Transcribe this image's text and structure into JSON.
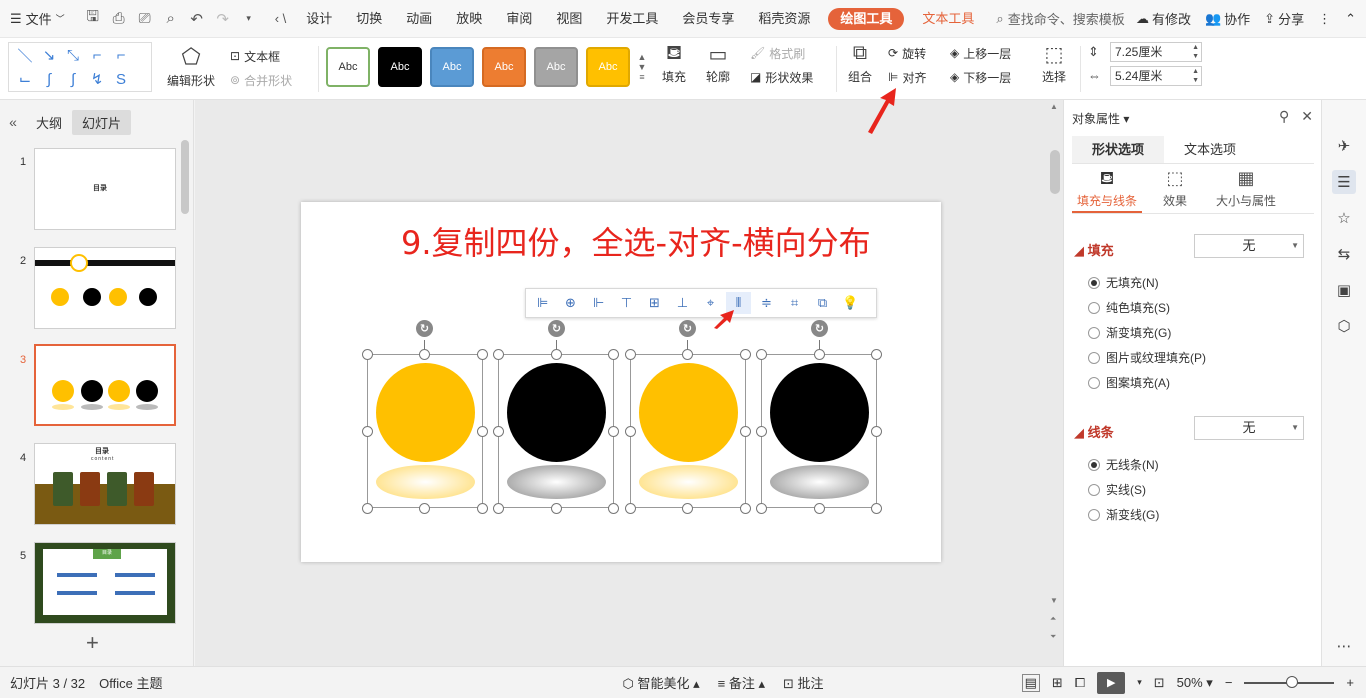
{
  "menubar": {
    "file_label": "文件",
    "tabs": [
      "设计",
      "切换",
      "动画",
      "放映",
      "审阅",
      "视图",
      "开发工具",
      "会员专享",
      "稻壳资源"
    ],
    "draw_tool": "绘图工具",
    "text_tool": "文本工具",
    "search_placeholder": "查找命令、搜索模板",
    "right": {
      "modify": "有修改",
      "collab": "协作",
      "share": "分享"
    }
  },
  "ribbon": {
    "edit_shape": "编辑形状",
    "textbox": "文本框",
    "merge_shape": "合并形状",
    "style_label": "Abc",
    "styles": [
      {
        "bg": "#ffffff",
        "fg": "#333333",
        "border": "#7fb266"
      },
      {
        "bg": "#000000",
        "fg": "#ffffff",
        "border": "#000000"
      },
      {
        "bg": "#5b9bd5",
        "fg": "#ffffff",
        "border": "#4a86bd"
      },
      {
        "bg": "#ed7d31",
        "fg": "#ffffff",
        "border": "#d56a22"
      },
      {
        "bg": "#a5a5a5",
        "fg": "#ffffff",
        "border": "#909090"
      },
      {
        "bg": "#ffc000",
        "fg": "#ffffff",
        "border": "#e0a800"
      }
    ],
    "fill": "填充",
    "outline": "轮廓",
    "format_brush": "格式刷",
    "shape_effect": "形状效果",
    "group": "组合",
    "rotate": "旋转",
    "align": "对齐",
    "bring_forward": "上移一层",
    "send_backward": "下移一层",
    "select": "选择",
    "height": "7.25厘米",
    "width": "5.24厘米"
  },
  "left_panel": {
    "tab_outline": "大纲",
    "tab_slides": "幻灯片",
    "slides": [
      {
        "num": "1",
        "label": "目录"
      },
      {
        "num": "2",
        "label": ""
      },
      {
        "num": "3",
        "label": ""
      },
      {
        "num": "4",
        "label": "目录",
        "sub": "content"
      },
      {
        "num": "5",
        "label": "目录"
      }
    ]
  },
  "slide": {
    "title": "9.复制四份，全选-对齐-横向分布",
    "circles": [
      {
        "color": "#ffc000",
        "shadow": "#ffd966"
      },
      {
        "color": "#000000",
        "shadow": "#8a8a8a"
      },
      {
        "color": "#ffc000",
        "shadow": "#ffd966"
      },
      {
        "color": "#000000",
        "shadow": "#8a8a8a"
      }
    ]
  },
  "right_panel": {
    "title": "对象属性",
    "tab_shape": "形状选项",
    "tab_text": "文本选项",
    "sub_fill_line": "填充与线条",
    "sub_effect": "效果",
    "sub_size": "大小与属性",
    "fill_section": "填充",
    "fill_value": "无",
    "fill_options": [
      "无填充(N)",
      "纯色填充(S)",
      "渐变填充(G)",
      "图片或纹理填充(P)",
      "图案填充(A)"
    ],
    "line_section": "线条",
    "line_value": "无",
    "line_options": [
      "无线条(N)",
      "实线(S)",
      "渐变线(G)"
    ]
  },
  "statusbar": {
    "slide_info": "幻灯片 3 / 32",
    "theme": "Office 主题",
    "smart_beauty": "智能美化",
    "notes": "备注",
    "comments": "批注",
    "zoom": "50%"
  },
  "colors": {
    "accent": "#e5633a",
    "title_red": "#e8251d"
  }
}
